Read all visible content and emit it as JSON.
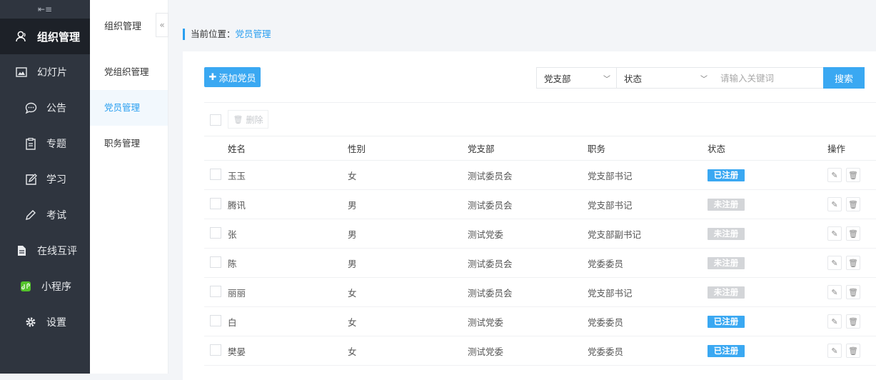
{
  "sidebar": {
    "collapse_icon": "menu-collapse-icon",
    "items": [
      {
        "label": "组织管理",
        "icon": "user-icon",
        "active": true
      },
      {
        "label": "幻灯片",
        "icon": "image-icon"
      },
      {
        "label": "公告",
        "icon": "chat-icon"
      },
      {
        "label": "专题",
        "icon": "clipboard-icon"
      },
      {
        "label": "学习",
        "icon": "edit-icon"
      },
      {
        "label": "考试",
        "icon": "pencil-icon"
      },
      {
        "label": "在线互评",
        "icon": "file-icon"
      },
      {
        "label": "小程序",
        "icon": "miniprogram-icon"
      },
      {
        "label": "设置",
        "icon": "gear-icon"
      }
    ]
  },
  "subnav": {
    "title": "组织管理",
    "toggle": "«",
    "items": [
      {
        "label": "党组织管理"
      },
      {
        "label": "党员管理",
        "active": true
      },
      {
        "label": "职务管理"
      }
    ]
  },
  "breadcrumb": {
    "prefix": "当前位置：",
    "current": "党员管理"
  },
  "toolbar": {
    "add_label": "添加党员",
    "filter_branch": "党支部",
    "filter_status": "状态",
    "search_placeholder": "请输入关键词",
    "search_label": "搜索",
    "delete_label": "删除"
  },
  "table": {
    "headers": [
      "姓名",
      "性别",
      "党支部",
      "职务",
      "状态",
      "操作"
    ],
    "rows": [
      {
        "name": "玉玉",
        "gender": "女",
        "branch": "测试委员会",
        "role": "党支部书记",
        "status": "已注册"
      },
      {
        "name": "腾讯",
        "gender": "男",
        "branch": "测试委员会",
        "role": "党支部书记",
        "status": "未注册"
      },
      {
        "name": "张",
        "gender": "男",
        "branch": "测试党委",
        "role": "党支部副书记",
        "status": "未注册"
      },
      {
        "name": "陈",
        "gender": "男",
        "branch": "测试委员会",
        "role": "党委委员",
        "status": "未注册"
      },
      {
        "name": "丽丽",
        "gender": "女",
        "branch": "测试委员会",
        "role": "党支部书记",
        "status": "未注册"
      },
      {
        "name": "白",
        "gender": "女",
        "branch": "测试党委",
        "role": "党委委员",
        "status": "已注册"
      },
      {
        "name": "樊晏",
        "gender": "女",
        "branch": "测试党委",
        "role": "党委委员",
        "status": "已注册"
      }
    ]
  },
  "colors": {
    "accent": "#3aa8f2",
    "sidebar_bg": "#2f353f",
    "sidebar_active": "#1d2128",
    "badge_off": "#d3d5d8"
  }
}
